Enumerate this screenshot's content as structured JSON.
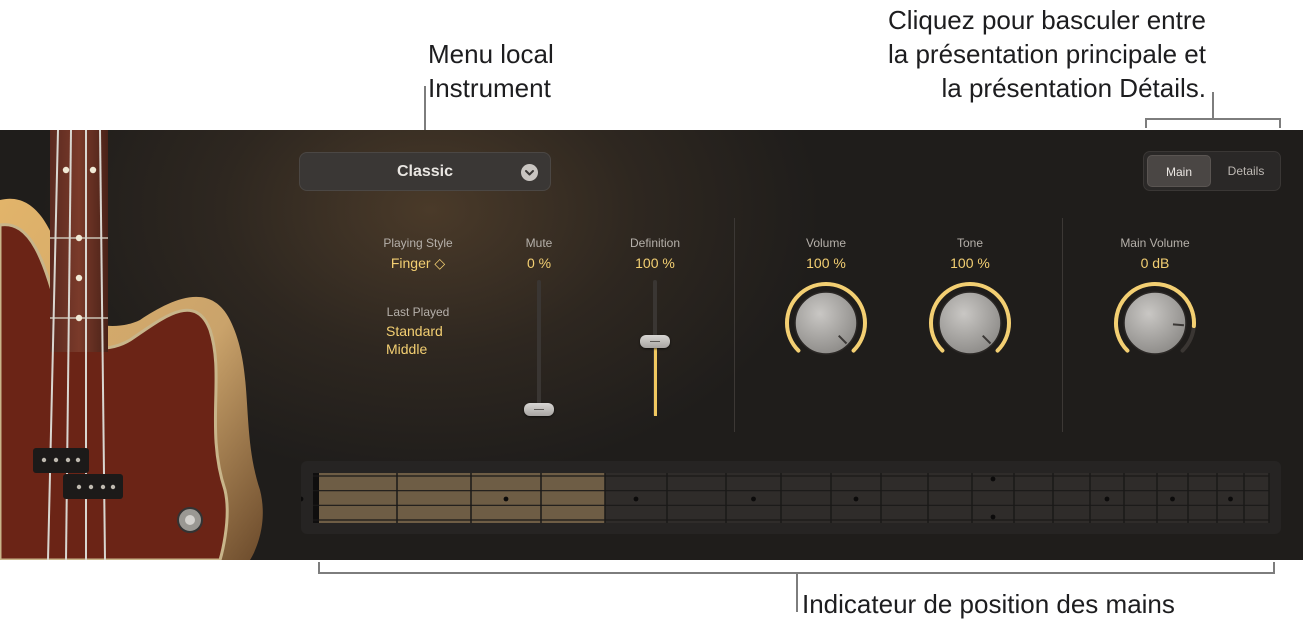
{
  "callouts": {
    "instrument_menu": "Menu local\nInstrument",
    "view_toggle": "Cliquez pour basculer entre\nla présentation principale et\nla présentation Détails.",
    "hand_position": "Indicateur de position des mains"
  },
  "instrument_menu": {
    "value": "Classic"
  },
  "view_toggle": {
    "main_label": "Main",
    "details_label": "Details",
    "active": "Main"
  },
  "playing_style": {
    "label": "Playing Style",
    "value": "Finger ◇"
  },
  "last_played": {
    "label": "Last Played",
    "value_line1": "Standard",
    "value_line2": "Middle"
  },
  "mute": {
    "label": "Mute",
    "value": "0 %",
    "level": 0.0
  },
  "definition": {
    "label": "Definition",
    "value": "100 %",
    "level": 0.55
  },
  "volume": {
    "label": "Volume",
    "value": "100 %",
    "level": 1.0
  },
  "tone": {
    "label": "Tone",
    "value": "100 %",
    "level": 1.0
  },
  "main_volume": {
    "label": "Main Volume",
    "value": "0 dB",
    "level": 0.85
  },
  "hand_position_indicator": {
    "highlighted_frets": 4
  },
  "colors": {
    "accent": "#f3cf72",
    "panel": "#1f1d1b",
    "callout_text": "#1d1d1f"
  }
}
